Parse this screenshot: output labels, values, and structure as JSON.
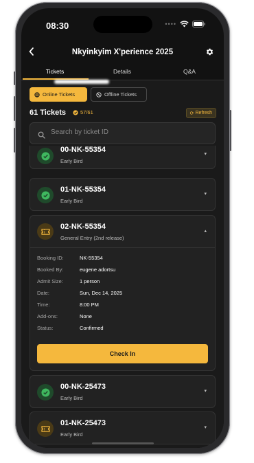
{
  "status_bar": {
    "time": "08:30"
  },
  "header": {
    "title": "Nkyinkyim X'perience 2025"
  },
  "tabs": [
    {
      "label": "Tickets",
      "active": true
    },
    {
      "label": "Details",
      "active": false
    },
    {
      "label": "Q&A",
      "active": false
    }
  ],
  "segments": {
    "online": "Online Tickets",
    "offline": "Offline Tickets"
  },
  "summary": {
    "count": "61 Tickets",
    "verified": "57/61",
    "refresh": "Refresh"
  },
  "search": {
    "placeholder": "Search by ticket ID"
  },
  "tickets": [
    {
      "code": "00-NK-55354",
      "type": "Early Bird",
      "status": "checked"
    },
    {
      "code": "01-NK-55354",
      "type": "Early Bird",
      "status": "checked"
    },
    {
      "code": "02-NK-55354",
      "type": "General Entry (2nd release)",
      "status": "pending",
      "expanded": true,
      "details": [
        {
          "label": "Booking ID:",
          "value": "NK-55354"
        },
        {
          "label": "Booked By:",
          "value": "eugene adortsu"
        },
        {
          "label": "Admit Size:",
          "value": "1 person"
        },
        {
          "label": "Date:",
          "value": "Sun, Dec 14, 2025"
        },
        {
          "label": "Time:",
          "value": "8:00 PM"
        },
        {
          "label": "Add-ons:",
          "value": "None"
        },
        {
          "label": "Status:",
          "value": "Confirmed"
        }
      ],
      "action": "Check In"
    },
    {
      "code": "00-NK-25473",
      "type": "Early Bird",
      "status": "checked"
    },
    {
      "code": "01-NK-25473",
      "type": "Early Bird",
      "status": "pending"
    }
  ],
  "colors": {
    "accent": "#f5b83d",
    "success": "#3fb85f",
    "background": "#121212"
  },
  "icons": {
    "back": "chevron-left-icon",
    "settings": "gear-icon",
    "search": "search-icon",
    "checked": "check-circle-icon",
    "pending": "ticket-icon",
    "refresh": "refresh-icon"
  }
}
